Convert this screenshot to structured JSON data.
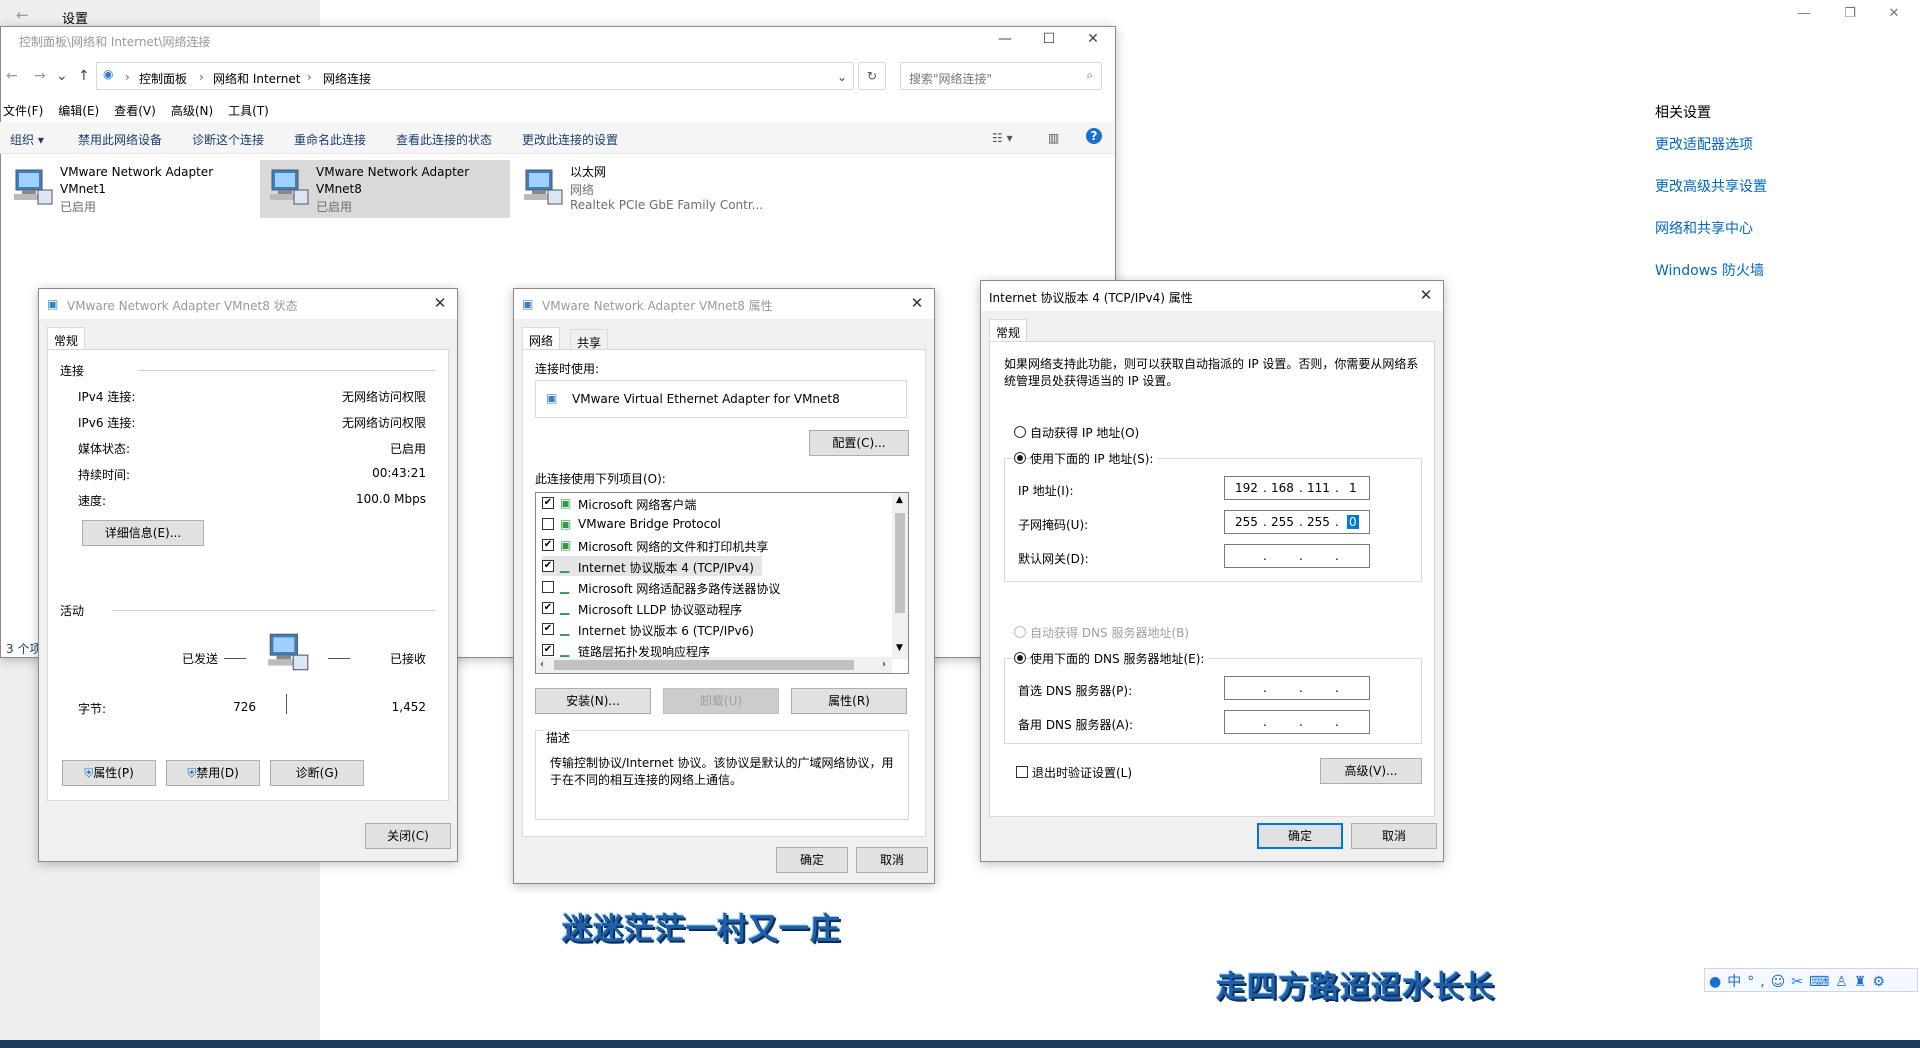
{
  "settings": {
    "title": "设置",
    "related_title": "相关设置",
    "links": [
      "更改适配器选项",
      "更改高级共享设置",
      "网络和共享中心",
      "Windows 防火墙"
    ]
  },
  "explorer": {
    "title": "控制面板\\网络和 Internet\\网络连接",
    "breadcrumb": [
      "控制面板",
      "网络和 Internet",
      "网络连接"
    ],
    "search_placeholder": "搜索\"网络连接\"",
    "menu": [
      "文件(F)",
      "编辑(E)",
      "查看(V)",
      "高级(N)",
      "工具(T)"
    ],
    "commands": [
      "组织 ▾",
      "禁用此网络设备",
      "诊断这个连接",
      "重命名此连接",
      "查看此连接的状态",
      "更改此连接的设置"
    ],
    "adapters": [
      {
        "name": "VMware Network Adapter VMnet1",
        "state": "已启用",
        "extra": ""
      },
      {
        "name": "VMware Network Adapter VMnet8",
        "state": "已启用",
        "extra": ""
      },
      {
        "name": "以太网",
        "state": "网络",
        "extra": "Realtek PCIe GbE Family Contr..."
      }
    ],
    "item_count": "3 个项"
  },
  "status_dialog": {
    "title": "VMware Network Adapter VMnet8 状态",
    "tab": "常规",
    "connection_header": "连接",
    "rows": [
      {
        "label": "IPv4 连接:",
        "value": "无网络访问权限"
      },
      {
        "label": "IPv6 连接:",
        "value": "无网络访问权限"
      },
      {
        "label": "媒体状态:",
        "value": "已启用"
      },
      {
        "label": "持续时间:",
        "value": "00:43:21"
      },
      {
        "label": "速度:",
        "value": "100.0 Mbps"
      }
    ],
    "details_btn": "详细信息(E)...",
    "activity_header": "活动",
    "sent_label": "已发送",
    "recv_label": "已接收",
    "bytes_label": "字节:",
    "bytes_sent": "726",
    "bytes_recv": "1,452",
    "btn_props": "属性(P)",
    "btn_disable": "禁用(D)",
    "btn_diag": "诊断(G)",
    "btn_close": "关闭(C)"
  },
  "props_dialog": {
    "title": "VMware Network Adapter VMnet8 属性",
    "tabs": [
      "网络",
      "共享"
    ],
    "connect_using": "连接时使用:",
    "adapter_name": "VMware Virtual Ethernet Adapter for VMnet8",
    "configure_btn": "配置(C)...",
    "items_label": "此连接使用下列项目(O):",
    "items": [
      {
        "checked": "✔",
        "label": "Microsoft 网络客户端"
      },
      {
        "checked": "",
        "label": "VMware Bridge Protocol"
      },
      {
        "checked": "✔",
        "label": "Microsoft 网络的文件和打印机共享"
      },
      {
        "checked": "✔",
        "label": "Internet 协议版本 4 (TCP/IPv4)"
      },
      {
        "checked": "",
        "label": "Microsoft 网络适配器多路传送器协议"
      },
      {
        "checked": "✔",
        "label": "Microsoft LLDP 协议驱动程序"
      },
      {
        "checked": "✔",
        "label": "Internet 协议版本 6 (TCP/IPv6)"
      },
      {
        "checked": "✔",
        "label": "链路层拓扑发现响应程序"
      }
    ],
    "install_btn": "安装(N)...",
    "uninstall_btn": "卸载(U)",
    "properties_btn": "属性(R)",
    "desc_header": "描述",
    "desc_text": "传输控制协议/Internet 协议。该协议是默认的广域网络协议，用于在不同的相互连接的网络上通信。",
    "ok_btn": "确定",
    "cancel_btn": "取消"
  },
  "ipv4_dialog": {
    "title": "Internet 协议版本 4 (TCP/IPv4) 属性",
    "tab": "常规",
    "intro": "如果网络支持此功能，则可以获取自动指派的 IP 设置。否则，你需要从网络系统管理员处获得适当的 IP 设置。",
    "auto_ip": "自动获得 IP 地址(O)",
    "manual_ip": "使用下面的 IP 地址(S):",
    "ip_label": "IP 地址(I):",
    "ip_value": [
      "192",
      "168",
      "111",
      "1"
    ],
    "mask_label": "子网掩码(U):",
    "mask_value": [
      "255",
      "255",
      "255",
      "0"
    ],
    "gw_label": "默认网关(D):",
    "auto_dns": "自动获得 DNS 服务器地址(B)",
    "manual_dns": "使用下面的 DNS 服务器地址(E):",
    "dns1_label": "首选 DNS 服务器(P):",
    "dns2_label": "备用 DNS 服务器(A):",
    "validate": "退出时验证设置(L)",
    "advanced_btn": "高级(V)...",
    "ok_btn": "确定",
    "cancel_btn": "取消"
  },
  "overlay": {
    "subtitle1": "迷迷茫茫一村又一庄",
    "subtitle2": "走四方路迢迢水长长"
  }
}
